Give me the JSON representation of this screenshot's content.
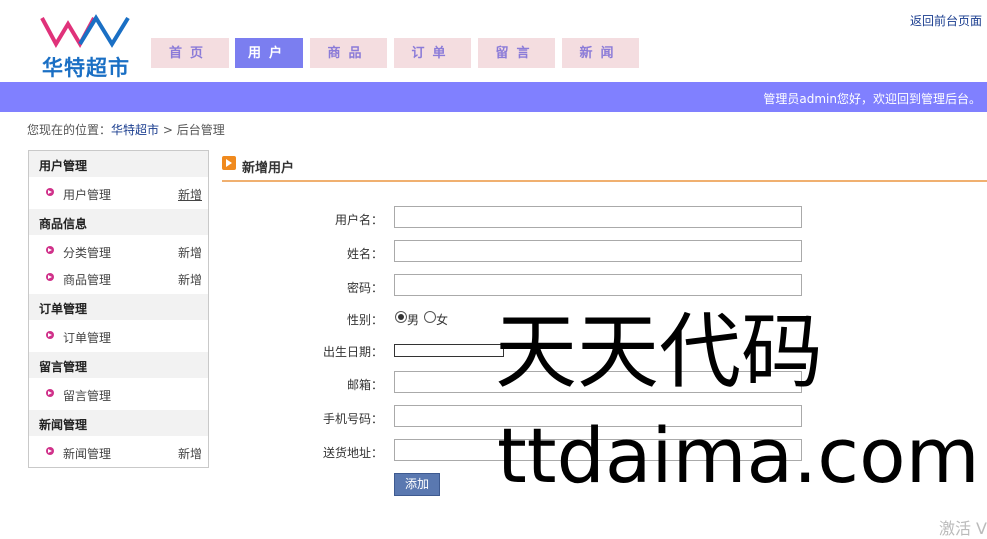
{
  "header": {
    "logo_text": "华特超市",
    "back_link": "返回前台页面",
    "tabs": [
      {
        "label": "首页",
        "active": false
      },
      {
        "label": "用户",
        "active": true
      },
      {
        "label": "商品",
        "active": false
      },
      {
        "label": "订单",
        "active": false
      },
      {
        "label": "留言",
        "active": false
      },
      {
        "label": "新闻",
        "active": false
      }
    ],
    "welcome": "管理员admin您好，欢迎回到管理后台。"
  },
  "breadcrumb": {
    "prefix": "您现在的位置：",
    "home": "华特超市",
    "separator": ">",
    "current": "后台管理"
  },
  "sidebar": {
    "categories": [
      {
        "title": "用户管理",
        "items": [
          {
            "label": "用户管理",
            "add": "新增",
            "add_underlined": true
          }
        ]
      },
      {
        "title": "商品信息",
        "items": [
          {
            "label": "分类管理",
            "add": "新增"
          },
          {
            "label": "商品管理",
            "add": "新增"
          }
        ]
      },
      {
        "title": "订单管理",
        "items": [
          {
            "label": "订单管理",
            "add": ""
          }
        ]
      },
      {
        "title": "留言管理",
        "items": [
          {
            "label": "留言管理",
            "add": ""
          }
        ]
      },
      {
        "title": "新闻管理",
        "items": [
          {
            "label": "新闻管理",
            "add": "新增"
          }
        ]
      }
    ]
  },
  "panel": {
    "title": "新增用户"
  },
  "form": {
    "username_label": "用户名：",
    "name_label": "姓名：",
    "password_label": "密码：",
    "gender_label": "性别：",
    "gender_male": "男",
    "gender_female": "女",
    "birthday_label": "出生日期：",
    "email_label": "邮箱：",
    "phone_label": "手机号码：",
    "address_label": "送货地址：",
    "submit": "添加"
  },
  "watermark": {
    "line1": "天天代码",
    "line2": "ttdaima.com"
  },
  "activate": "激活 V",
  "colors": {
    "tab_active": "#7b7ef0",
    "tab_inactive": "#f4dde0",
    "welcome_bar": "#8080ff",
    "bullet": "#d0318a",
    "accent_orange": "#f08a1e"
  }
}
